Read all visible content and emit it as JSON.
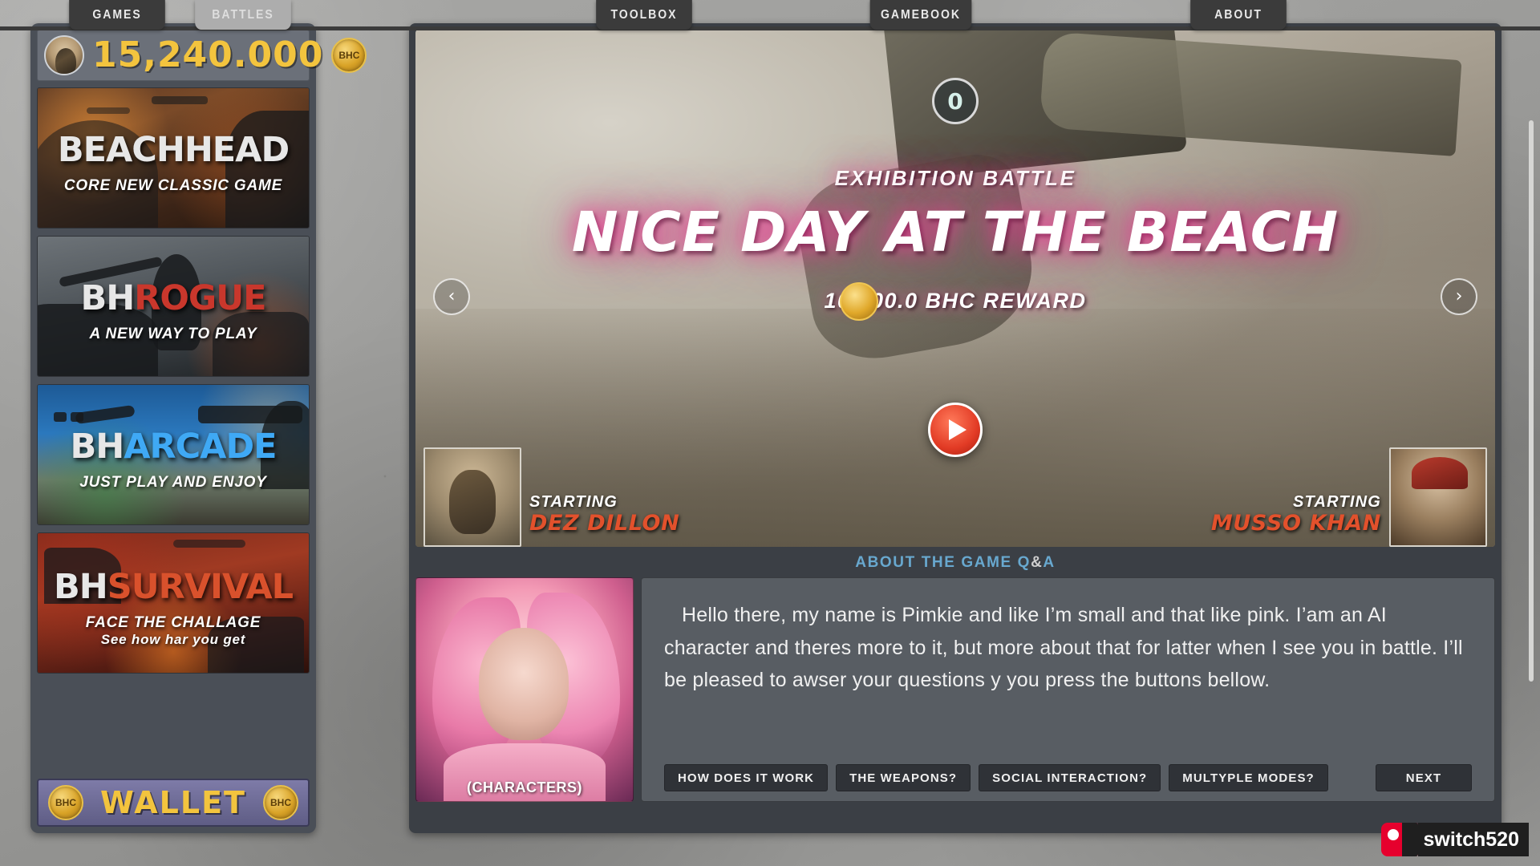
{
  "tabs": [
    {
      "label": "GAMES",
      "active": true
    },
    {
      "label": "BATTLES",
      "active": false
    },
    {
      "label": "TOOLBOX",
      "active": true
    },
    {
      "label": "GAMEBOOK",
      "active": true
    },
    {
      "label": "ABOUT",
      "active": true
    }
  ],
  "sidebar": {
    "wallet_balance": "15,240.000",
    "coin_label": "BHC",
    "wallet_button_label": "WALLET",
    "cards": [
      {
        "title_prefix": "BEACH",
        "title_suffix": "HEAD",
        "subtitle": "CORE NEW CLASSIC GAME",
        "subtitle2": ""
      },
      {
        "title_prefix": "BH",
        "title_suffix": "ROGUE",
        "subtitle": "A NEW WAY TO PLAY",
        "subtitle2": ""
      },
      {
        "title_prefix": "BH",
        "title_suffix": "ARCADE",
        "subtitle": "JUST PLAY AND ENJOY",
        "subtitle2": ""
      },
      {
        "title_prefix": "BH",
        "title_suffix": "SURVIVAL",
        "subtitle": "FACE THE CHALLAGE",
        "subtitle2": "See how har you get"
      }
    ]
  },
  "hero": {
    "round_badge": "0",
    "kicker": "EXHIBITION BATTLE",
    "title": "NICE DAY AT THE BEACH",
    "reward": "10,000.0 BHC REWARD",
    "prev_arrow": "‹",
    "next_arrow": "›",
    "fighter_left": {
      "starting_label": "STARTING",
      "name": "DEZ DILLON"
    },
    "fighter_right": {
      "starting_label": "STARTING",
      "name": "MUSSO KHAN"
    }
  },
  "qa": {
    "header_main": "ABOUT THE GAME ",
    "header_q": "Q",
    "header_amp": "&",
    "header_a": "A",
    "character_caption": "(CHARACTERS)",
    "dialog": "Hello there, my name is Pimkie and like I’m small and that like pink. I’am an AI character and theres more to it, but more about that for latter when I see you in battle. I’ll be pleased to awser your questions y you press the buttons bellow.",
    "buttons": [
      "HOW DOES IT WORK",
      "THE WEAPONS?",
      "SOCIAL INTERACTION?",
      "MULTYPLE MODES?"
    ],
    "next_label": "NEXT"
  },
  "watermark": {
    "text": "switch520"
  },
  "colors": {
    "gold": "#f3c43e",
    "accent_red": "#e2512c",
    "panel": "#3b3f45",
    "sidebar": "#4a4f57",
    "qa_link": "#68a8cf"
  }
}
